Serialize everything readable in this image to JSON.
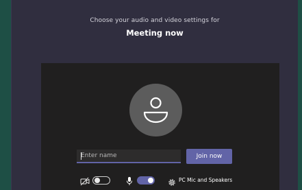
{
  "dialog": {
    "subtitle": "Choose your audio and video settings for",
    "meeting_title": "Meeting now"
  },
  "join_form": {
    "name_placeholder": "Enter name",
    "name_value": "",
    "join_label": "Join now"
  },
  "controls": {
    "camera_icon": "camera-off-icon",
    "camera_on": false,
    "mic_icon": "microphone-icon",
    "mic_on": true,
    "settings_icon": "gear-icon",
    "device_label": "PC Mic and Speakers"
  },
  "colors": {
    "accent": "#6264a7",
    "background": "#1e4f45",
    "dialog": "#302e3f",
    "preview": "#201f1f",
    "avatar": "#5c5c5c"
  }
}
